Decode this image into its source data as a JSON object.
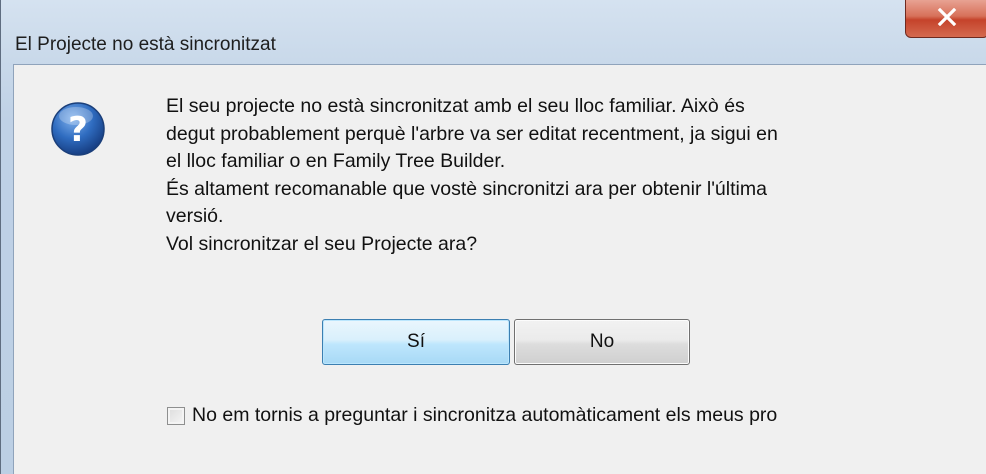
{
  "window": {
    "title": "El Projecte no està sincronitzat",
    "close_icon": "close-x-icon"
  },
  "dialog": {
    "icon": "question-icon",
    "message_lines": [
      "El seu projecte no està sincronitzat amb el seu lloc familiar. Això és",
      "degut probablement perquè l'arbre va ser editat recentment, ja sigui en",
      "el lloc familiar o en Family Tree Builder.",
      "És altament recomanable que vostè sincronitzi ara per obtenir l'última",
      "versió.",
      "Vol sincronitzar el seu Projecte ara?"
    ],
    "yes_label": "Sí",
    "no_label": "No",
    "checkbox_label": "No em tornis a preguntar i sincronitza automàticament els meus pro",
    "checkbox_checked": false
  },
  "colors": {
    "close_button": "#c5432b",
    "icon_blue": "#2a63b0",
    "default_button_border": "#3c7fb1"
  }
}
